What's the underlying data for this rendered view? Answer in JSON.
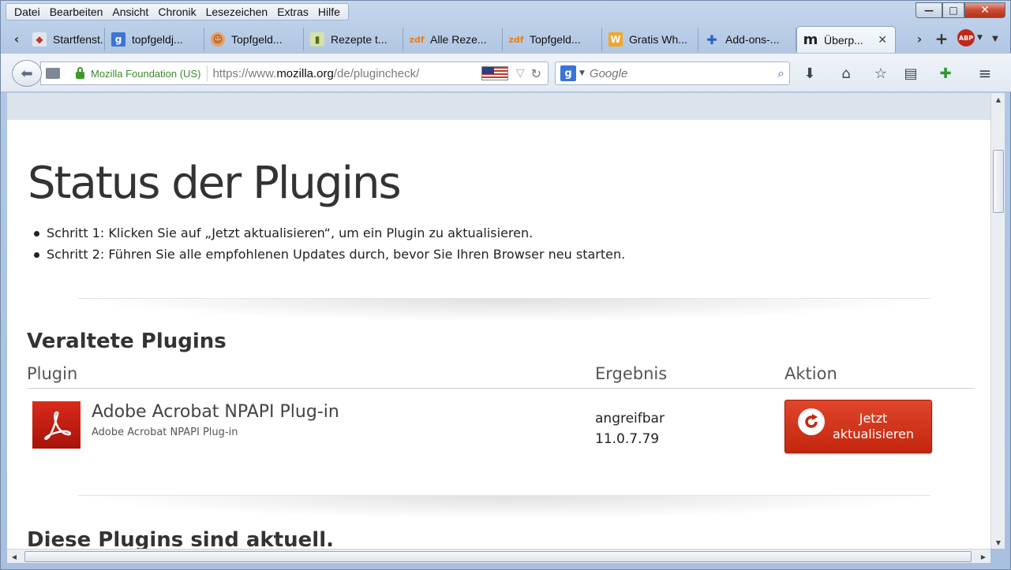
{
  "menu": [
    "Datei",
    "Bearbeiten",
    "Ansicht",
    "Chronik",
    "Lesezeichen",
    "Extras",
    "Hilfe"
  ],
  "window_controls": {
    "minimize": "—",
    "maximize": "□",
    "close": "✕"
  },
  "tabs": [
    {
      "label": "Startfenst...",
      "icon": "firefox-icon"
    },
    {
      "label": "topfgeldj...",
      "icon": "google-icon"
    },
    {
      "label": "Topfgeld...",
      "icon": "chef-icon"
    },
    {
      "label": "Rezepte t...",
      "icon": "recipe-icon"
    },
    {
      "label": "Alle Reze...",
      "icon": "zdf-icon"
    },
    {
      "label": "Topfgeld...",
      "icon": "zdf-icon"
    },
    {
      "label": "Gratis Wh...",
      "icon": "w-icon"
    },
    {
      "label": "Add-ons-...",
      "icon": "puzzle-icon"
    },
    {
      "label": "Überp...",
      "icon": "mozilla-icon",
      "active": true
    }
  ],
  "urlbar": {
    "identity": "Mozilla Foundation (US)",
    "url_prefix": "https://www.",
    "url_domain": "mozilla.org",
    "url_path": "/de/plugincheck/"
  },
  "search": {
    "placeholder": "Google",
    "engine_letter": "g"
  },
  "page": {
    "title": "Status der Plugins",
    "steps": [
      "Schritt 1: Klicken Sie auf „Jetzt aktualisieren“, um ein Plugin zu aktualisieren.",
      "Schritt 2: Führen Sie alle empfohlenen Updates durch, bevor Sie Ihren Browser neu starten."
    ],
    "outdated_title": "Veraltete Plugins",
    "columns": {
      "plugin": "Plugin",
      "result": "Ergebnis",
      "action": "Aktion"
    },
    "plugin": {
      "name": "Adobe Acrobat NPAPI Plug-in",
      "description": "Adobe Acrobat NPAPI Plug-in",
      "status": "angreifbar",
      "version": "11.0.7.79",
      "button_line1": "Jetzt",
      "button_line2": "aktualisieren"
    },
    "current_title": "Diese Plugins sind aktuell."
  },
  "colors": {
    "update_button": "#d3361d",
    "identity_green": "#3c8a2a",
    "acrobat_red": "#c61f12"
  }
}
